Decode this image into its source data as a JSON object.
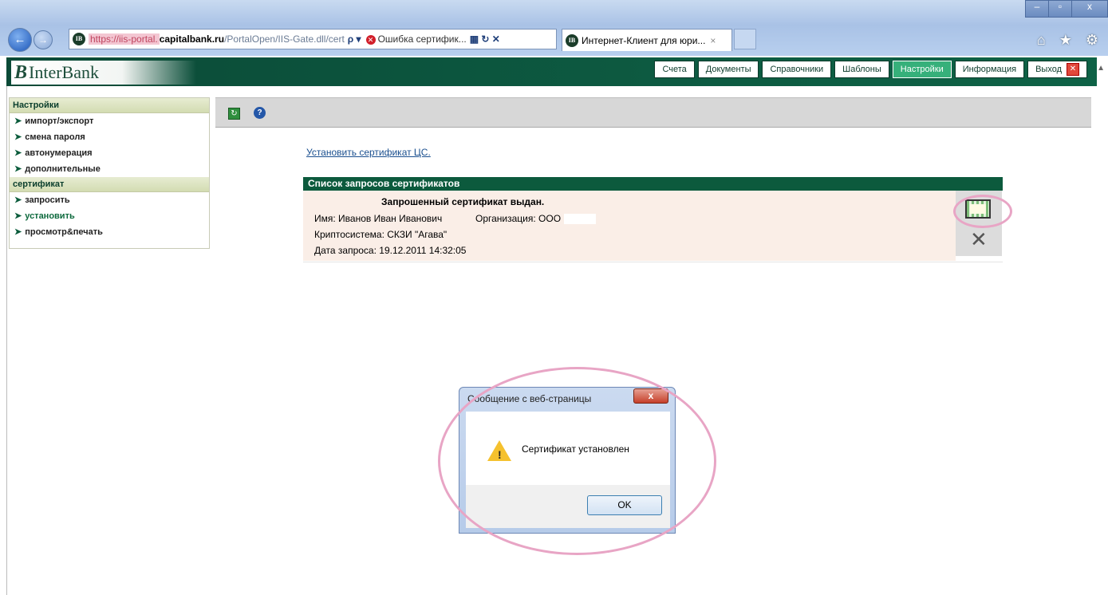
{
  "browser": {
    "address": {
      "prefix": "https://iis-portal.",
      "host": "capitalbank.ru",
      "path": "/PortalOpen/IIS-Gate.dll/cert",
      "icons": "ρ ▾",
      "cert_error": "Ошибка сертифик...",
      "cert_icons": "▦ ↻ ✕"
    },
    "tab": {
      "title": "Интернет-Клиент для юри...",
      "close": "×"
    },
    "controls": {
      "minimize": "–",
      "maximize": "▫",
      "close": "x"
    },
    "right_icons": "⌂ ★ ⚙"
  },
  "app": {
    "logo_mark": "B",
    "logo_text": "InterBank",
    "nav": [
      {
        "label": "Счета"
      },
      {
        "label": "Документы"
      },
      {
        "label": "Справочники"
      },
      {
        "label": "Шаблоны"
      },
      {
        "label": "Настройки",
        "active": true
      },
      {
        "label": "Информация"
      },
      {
        "label": "Выход"
      }
    ]
  },
  "sidebar": {
    "section1": "Настройки",
    "items1": [
      "импорт/экспорт",
      "смена пароля",
      "автонумерация",
      "дополнительные"
    ],
    "section2": "сертификат",
    "items2": [
      "запросить",
      "установить",
      "просмотр&печать"
    ]
  },
  "main": {
    "install_ca": "Установить сертификат ЦС.",
    "panel_title": "Список запросов сертификатов",
    "status": "Запрошенный сертификат выдан.",
    "name": "Имя: Иванов Иван Иванович",
    "org": "Организация: ООО",
    "crypto": "Криптосистема: СКЗИ \"Агава\"",
    "date": "Дата запроса: 19.12.2011 14:32:05"
  },
  "dialog": {
    "title": "Сообщение с веб-страницы",
    "message": "Сертификат установлен",
    "ok": "OK",
    "close": "x"
  },
  "colors": {
    "brand_green": "#0c5a3d",
    "active_nav": "#36b07a",
    "panel_bg": "#faeee7",
    "highlight": "#e8a5c5"
  }
}
